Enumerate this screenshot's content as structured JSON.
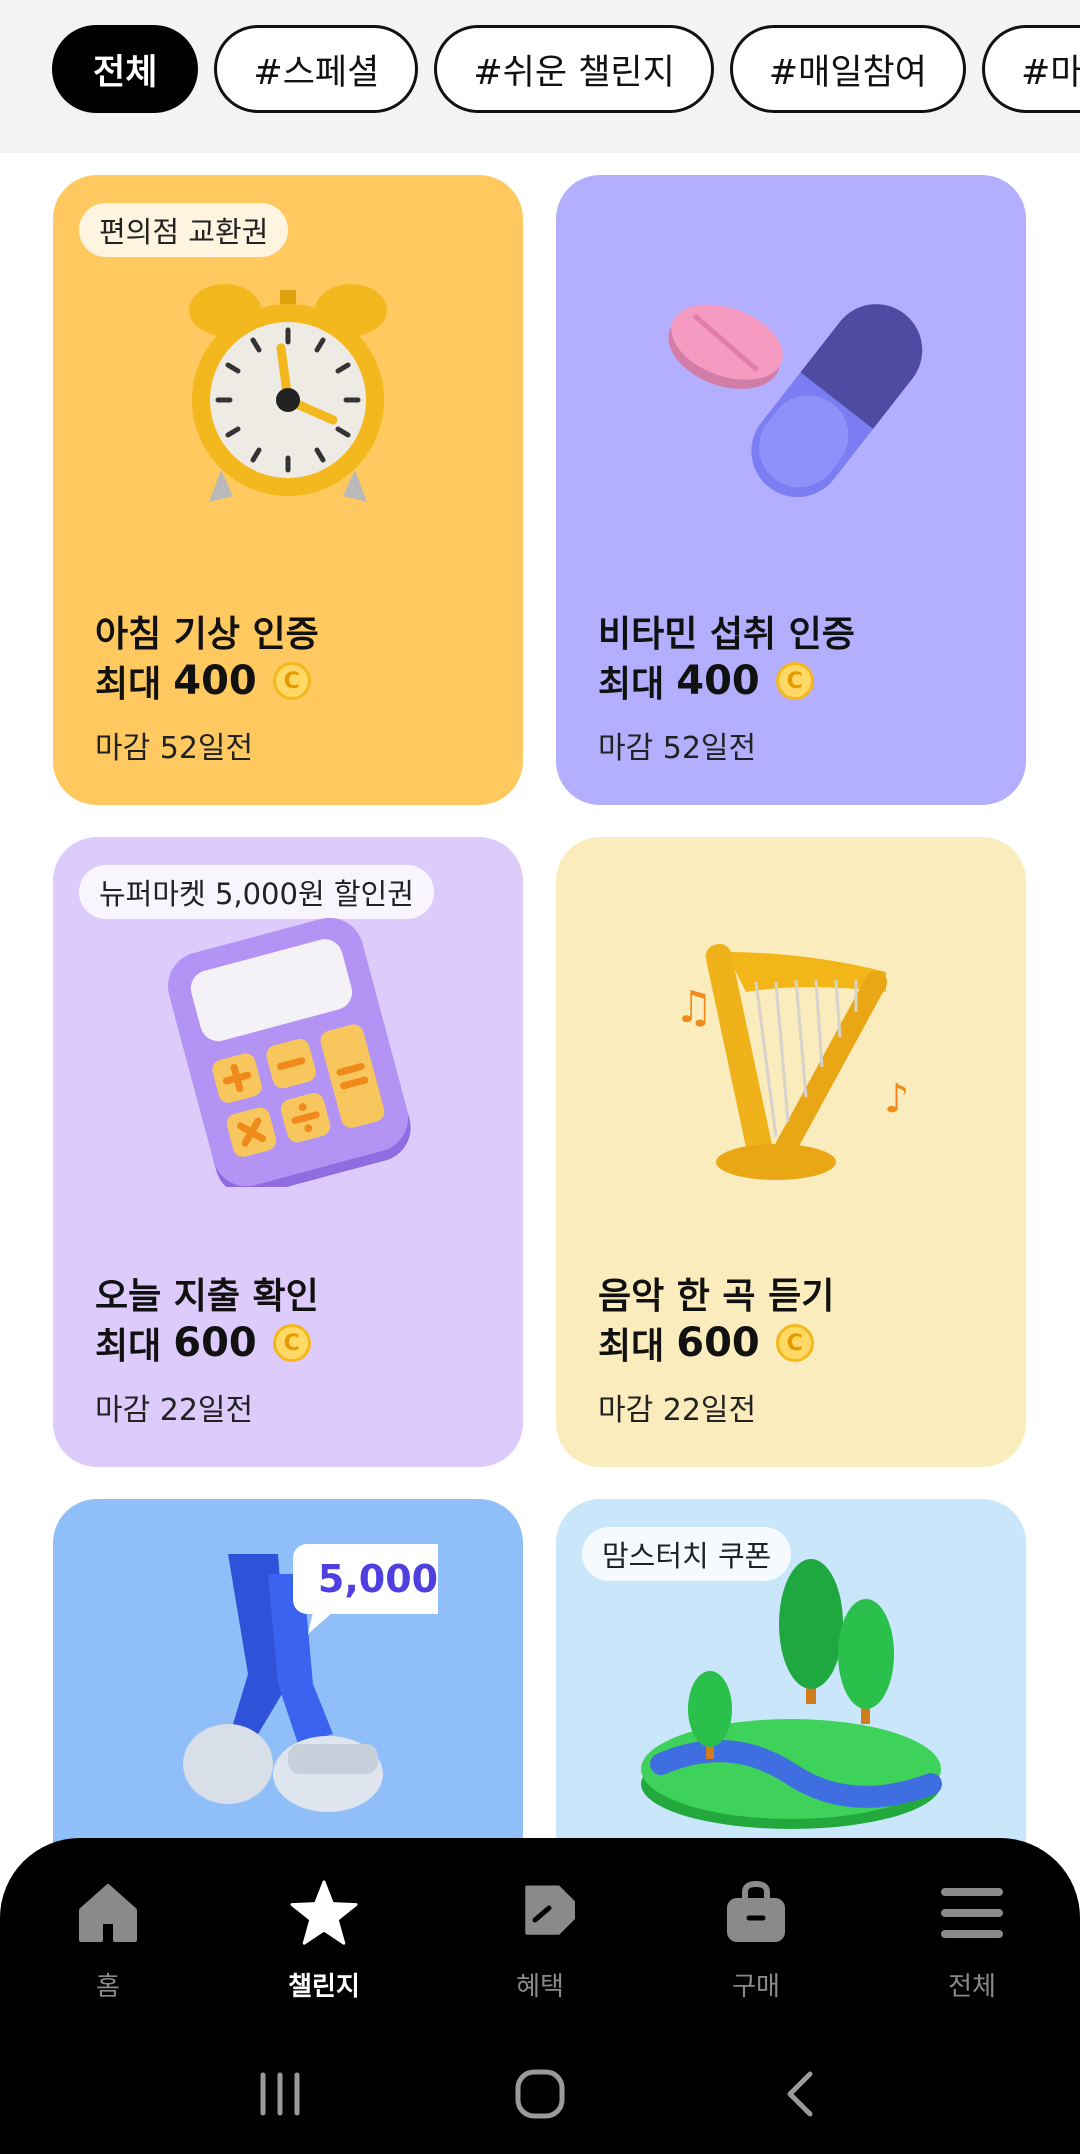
{
  "filters": {
    "items": [
      "전체",
      "#스페셜",
      "#쉬운 챌린지",
      "#매일참여",
      "#마음 설"
    ],
    "selected": "전체"
  },
  "cards": [
    {
      "badge": "편의점 교환권",
      "title": "아침 기상 인증",
      "reward_prefix": "최대",
      "reward": "400",
      "coin": "C",
      "deadline": "마감 52일전",
      "bg": "#ffc960",
      "illustration": "alarm-clock"
    },
    {
      "badge": "",
      "title": "비타민 섭취 인증",
      "reward_prefix": "최대",
      "reward": "400",
      "coin": "C",
      "deadline": "마감 52일전",
      "bg": "#b3aefd",
      "illustration": "pills"
    },
    {
      "badge": "뉴퍼마켓 5,000원 할인권",
      "title": "오늘 지출 확인",
      "reward_prefix": "최대",
      "reward": "600",
      "coin": "C",
      "deadline": "마감 22일전",
      "bg": "#ddcbfb",
      "illustration": "calculator"
    },
    {
      "badge": "",
      "title": "음악 한 곡 듣기",
      "reward_prefix": "최대",
      "reward": "600",
      "coin": "C",
      "deadline": "마감 22일전",
      "bg": "#faecbc",
      "illustration": "harp"
    },
    {
      "badge": "",
      "title": "",
      "steps_bubble": "5,000",
      "bg": "#8fbef8",
      "illustration": "walking-legs"
    },
    {
      "badge": "맘스터치 쿠폰",
      "title": "",
      "bg": "#c9e6fb",
      "illustration": "park-island"
    }
  ],
  "bottom_nav": {
    "items": [
      {
        "label": "홈",
        "icon": "home-icon"
      },
      {
        "label": "챌린지",
        "icon": "star-icon"
      },
      {
        "label": "혜택",
        "icon": "tag-icon"
      },
      {
        "label": "구매",
        "icon": "bag-icon"
      },
      {
        "label": "전체",
        "icon": "menu-icon"
      }
    ],
    "active": "챌린지"
  },
  "system_nav": [
    "recent-apps-icon",
    "home-circle-icon",
    "back-icon"
  ],
  "colors": {
    "accent": "#000000",
    "coin": "#ffd866",
    "inactive_nav": "#8a8a8a"
  }
}
